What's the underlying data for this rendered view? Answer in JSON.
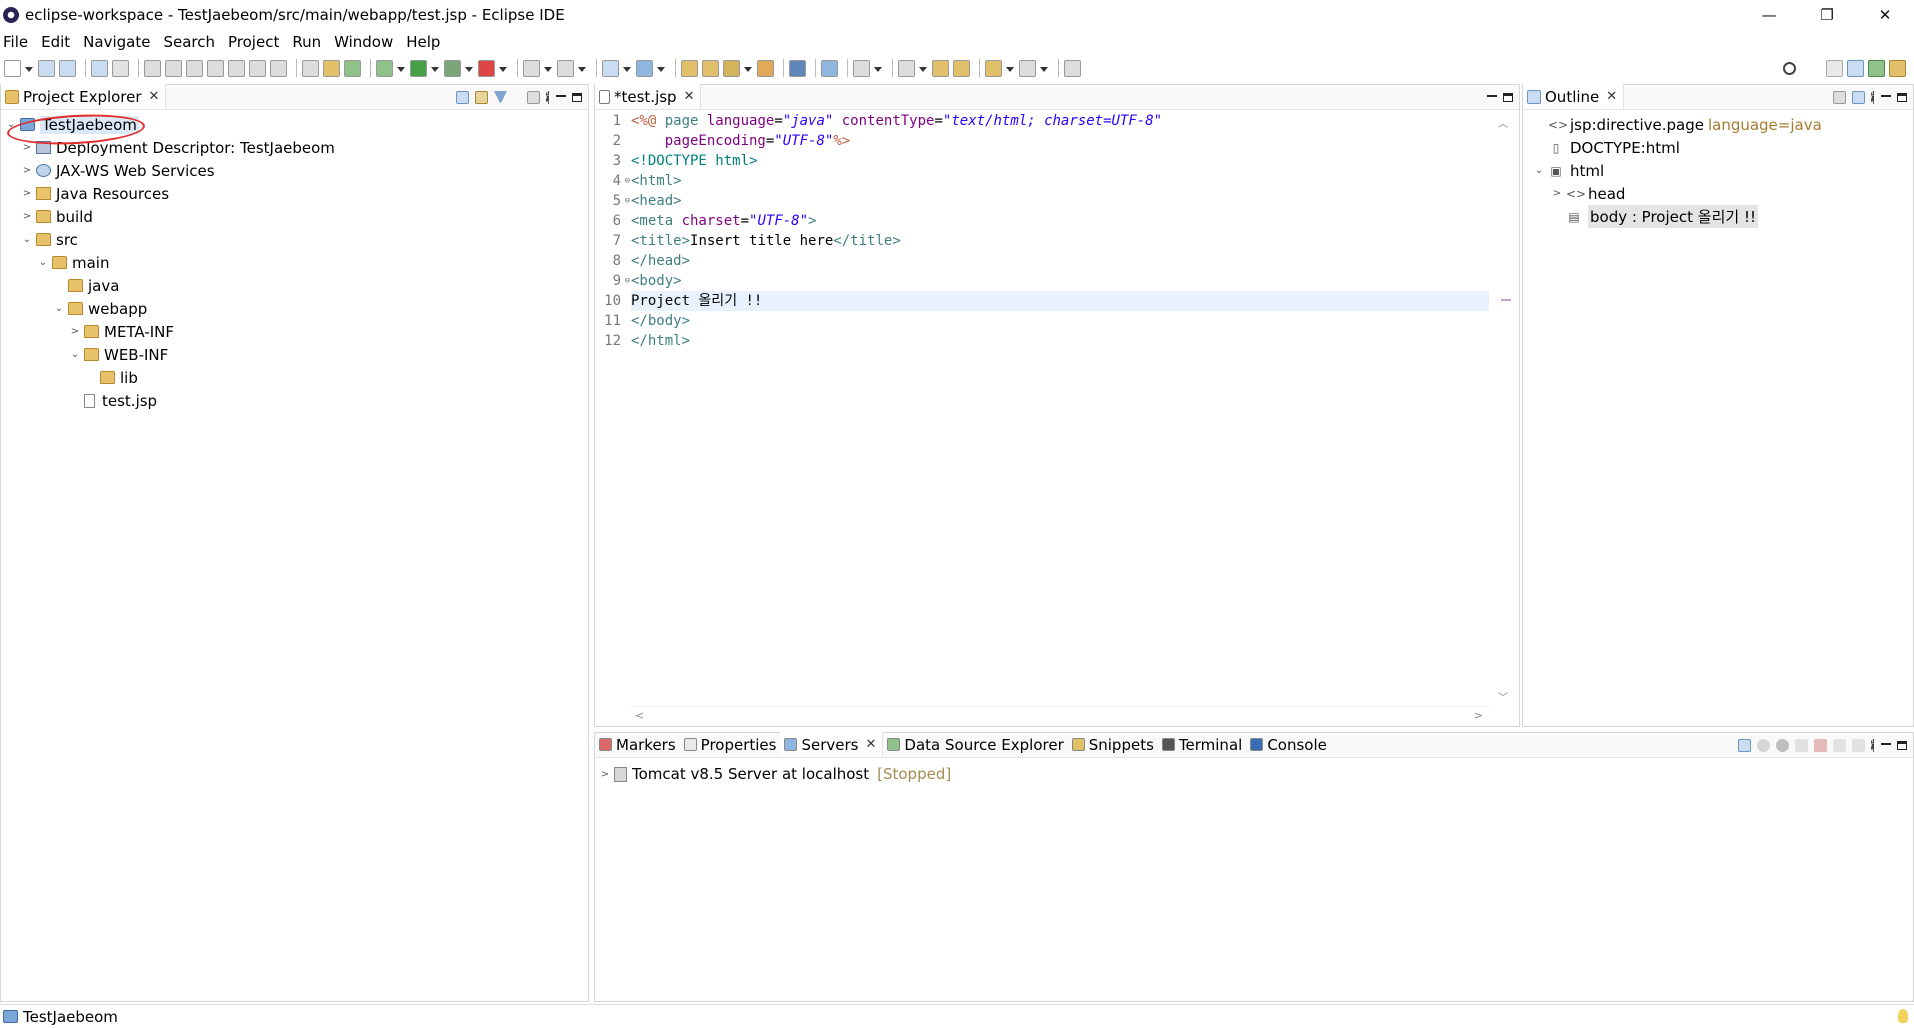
{
  "window": {
    "title": "eclipse-workspace - TestJaebeom/src/main/webapp/test.jsp - Eclipse IDE",
    "minimize": "—",
    "restore": "❐",
    "close": "✕"
  },
  "menu": [
    "File",
    "Edit",
    "Navigate",
    "Search",
    "Project",
    "Run",
    "Window",
    "Help"
  ],
  "project_explorer": {
    "tab_label": "Project Explorer",
    "tree": [
      {
        "label": "TestJaebeom",
        "indent": 0,
        "twisty": "v",
        "icon": "project"
      },
      {
        "label": "Deployment Descriptor: TestJaebeom",
        "indent": 1,
        "twisty": ">",
        "icon": "descriptor"
      },
      {
        "label": "JAX-WS Web Services",
        "indent": 1,
        "twisty": ">",
        "icon": "webservice"
      },
      {
        "label": "Java Resources",
        "indent": 1,
        "twisty": ">",
        "icon": "java-resources"
      },
      {
        "label": "build",
        "indent": 1,
        "twisty": ">",
        "icon": "folder"
      },
      {
        "label": "src",
        "indent": 1,
        "twisty": "v",
        "icon": "folder"
      },
      {
        "label": "main",
        "indent": 2,
        "twisty": "v",
        "icon": "folder"
      },
      {
        "label": "java",
        "indent": 3,
        "twisty": "",
        "icon": "folder"
      },
      {
        "label": "webapp",
        "indent": 3,
        "twisty": "v",
        "icon": "folder"
      },
      {
        "label": "META-INF",
        "indent": 4,
        "twisty": ">",
        "icon": "folder"
      },
      {
        "label": "WEB-INF",
        "indent": 4,
        "twisty": "v",
        "icon": "folder"
      },
      {
        "label": "lib",
        "indent": 5,
        "twisty": "",
        "icon": "folder"
      },
      {
        "label": "test.jsp",
        "indent": 4,
        "twisty": "",
        "icon": "file"
      }
    ]
  },
  "editor": {
    "tab_label": "*test.jsp",
    "line_numbers": [
      "1",
      "2",
      "3",
      "4",
      "5",
      "6",
      "7",
      "8",
      "9",
      "10",
      "11",
      "12"
    ],
    "current_line": "10",
    "lines": [
      [
        {
          "t": "<%@ ",
          "c": "t-dir"
        },
        {
          "t": "page ",
          "c": "t-tag"
        },
        {
          "t": "language",
          "c": "t-attr"
        },
        {
          "t": "=",
          "c": "t-text"
        },
        {
          "t": "\"java\"",
          "c": "t-val"
        },
        {
          "t": " contentType",
          "c": "t-attr"
        },
        {
          "t": "=",
          "c": "t-text"
        },
        {
          "t": "\"text/html; charset=UTF-8\"",
          "c": "t-val"
        }
      ],
      [
        {
          "t": "    pageEncoding",
          "c": "t-attr"
        },
        {
          "t": "=",
          "c": "t-text"
        },
        {
          "t": "\"UTF-8\"",
          "c": "t-val"
        },
        {
          "t": "%>",
          "c": "t-dir"
        }
      ],
      [
        {
          "t": "<!DOCTYPE html>",
          "c": "t-doc"
        }
      ],
      [
        {
          "t": "<html>",
          "c": "t-tag"
        }
      ],
      [
        {
          "t": "<head>",
          "c": "t-tag"
        }
      ],
      [
        {
          "t": "<meta ",
          "c": "t-tag"
        },
        {
          "t": "charset",
          "c": "t-attr"
        },
        {
          "t": "=",
          "c": "t-text"
        },
        {
          "t": "\"UTF-8\"",
          "c": "t-val"
        },
        {
          "t": ">",
          "c": "t-tag"
        }
      ],
      [
        {
          "t": "<title>",
          "c": "t-tag"
        },
        {
          "t": "Insert title here",
          "c": "t-text"
        },
        {
          "t": "</title>",
          "c": "t-tag"
        }
      ],
      [
        {
          "t": "</head>",
          "c": "t-tag"
        }
      ],
      [
        {
          "t": "<body>",
          "c": "t-tag"
        }
      ],
      [
        {
          "t": "Project 올리기 !!",
          "c": "t-text"
        }
      ],
      [
        {
          "t": "</body>",
          "c": "t-tag"
        }
      ],
      [
        {
          "t": "</html>",
          "c": "t-tag"
        }
      ]
    ]
  },
  "outline": {
    "tab_label": "Outline",
    "items": [
      {
        "label": "jsp:directive.page",
        "attr": "language=java",
        "indent": 0,
        "twisty": "",
        "icon": "<>"
      },
      {
        "label": "DOCTYPE:html",
        "attr": "",
        "indent": 0,
        "twisty": "",
        "icon": "▯"
      },
      {
        "label": "html",
        "attr": "",
        "indent": 0,
        "twisty": "v",
        "icon": "▣"
      },
      {
        "label": "head",
        "attr": "",
        "indent": 1,
        "twisty": ">",
        "icon": "<>"
      },
      {
        "label": "body : Project 올리기 !!",
        "attr": "",
        "indent": 1,
        "twisty": "",
        "icon": "▤",
        "selected": true
      }
    ]
  },
  "bottom_panel": {
    "tabs": [
      {
        "label": "Markers",
        "active": false
      },
      {
        "label": "Properties",
        "active": false
      },
      {
        "label": "Servers",
        "active": true
      },
      {
        "label": "Data Source Explorer",
        "active": false
      },
      {
        "label": "Snippets",
        "active": false
      },
      {
        "label": "Terminal",
        "active": false
      },
      {
        "label": "Console",
        "active": false
      }
    ],
    "server": {
      "name": "Tomcat v8.5 Server at localhost",
      "state": "[Stopped]"
    }
  },
  "status_bar": {
    "text": "TestJaebeom"
  },
  "colors": {
    "selection": "#dbe8f7",
    "annotation": "#e22a2a",
    "current_line": "#e8f2fe"
  }
}
